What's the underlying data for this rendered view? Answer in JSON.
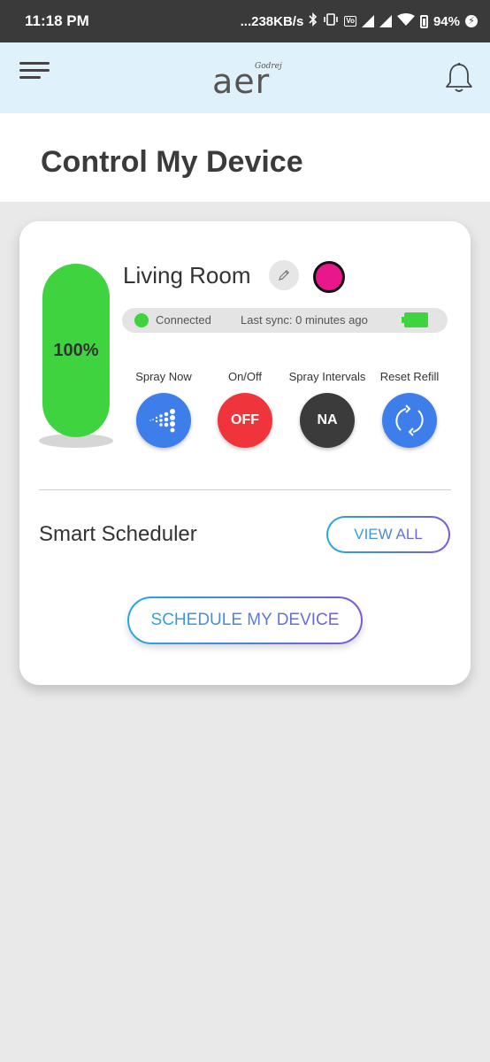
{
  "status_bar": {
    "time": "11:18 PM",
    "network_speed": "...238KB/s",
    "volte": "Vo LTE",
    "battery_percent": "94%"
  },
  "header": {
    "logo_brand": "Godrej",
    "logo_word": "aer",
    "icons": [
      "menu-icon",
      "bell-icon"
    ]
  },
  "page": {
    "title": "Control My Device"
  },
  "device": {
    "room_name": "Living Room",
    "refill_level": "100%",
    "refill_fraction": 1.0,
    "color": "#e8188a",
    "status": "Connected",
    "last_sync": "Last sync: 0 minutes ago",
    "controls": [
      {
        "label": "Spray Now",
        "value": "",
        "icon": "spray-icon"
      },
      {
        "label": "On/Off",
        "value": "OFF"
      },
      {
        "label": "Spray Intervals",
        "value": "NA"
      },
      {
        "label": "Reset Refill",
        "value": "",
        "icon": "refresh-icon"
      }
    ]
  },
  "scheduler": {
    "title": "Smart Scheduler",
    "view_all_label": "VIEW ALL",
    "schedule_label": "SCHEDULE MY DEVICE"
  },
  "colors": {
    "accent_green": "#3fd340",
    "accent_blue": "#3d7eea",
    "off_red": "#f0343c",
    "header_bg": "#dff1fb"
  }
}
